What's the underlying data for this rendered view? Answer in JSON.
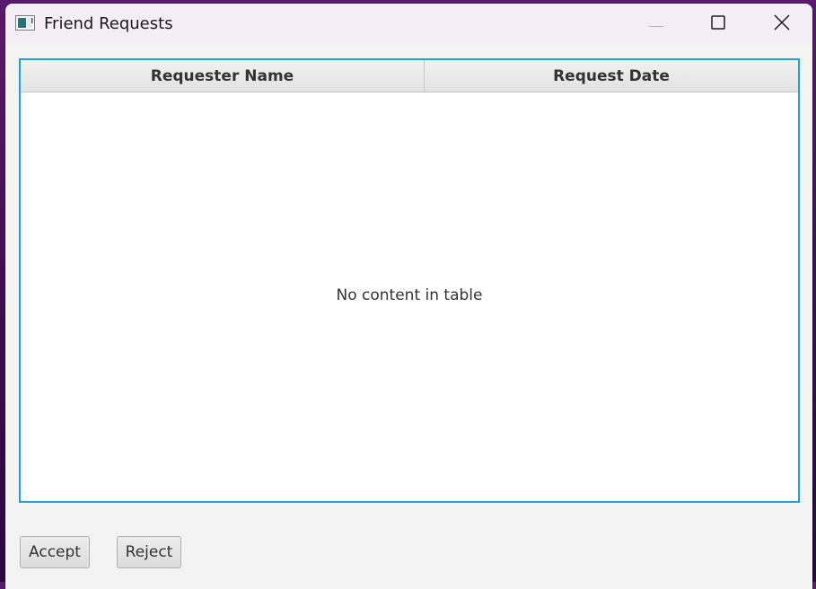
{
  "window": {
    "title": "Friend Requests"
  },
  "table": {
    "columns": [
      "Requester Name",
      "Request Date"
    ],
    "rows": [],
    "placeholder": "No content in table"
  },
  "actions": {
    "accept_label": "Accept",
    "reject_label": "Reject"
  },
  "colors": {
    "focus_border": "#1ea0da",
    "window_bg": "#f3f3f3"
  }
}
